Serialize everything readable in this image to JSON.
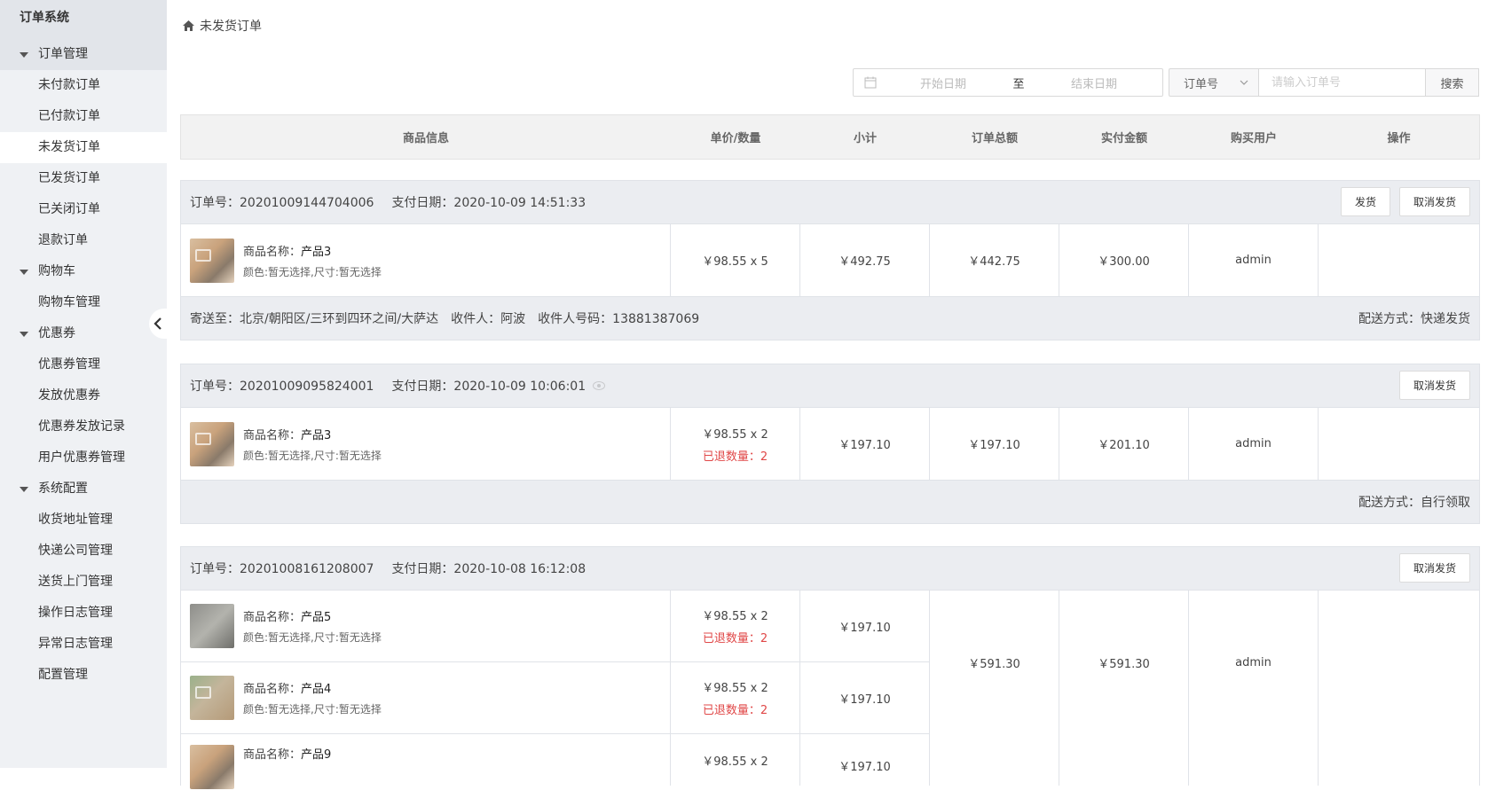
{
  "sidebar": {
    "title": "订单系统",
    "groups": [
      {
        "label": "订单管理",
        "items": [
          "未付款订单",
          "已付款订单",
          "未发货订单",
          "已发货订单",
          "已关闭订单",
          "退款订单"
        ]
      },
      {
        "label": "购物车",
        "items": [
          "购物车管理"
        ]
      },
      {
        "label": "优惠券",
        "items": [
          "优惠券管理",
          "发放优惠券",
          "优惠券发放记录",
          "用户优惠券管理"
        ]
      },
      {
        "label": "系统配置",
        "items": [
          "收货地址管理",
          "快递公司管理",
          "送货上门管理",
          "操作日志管理",
          "异常日志管理",
          "配置管理"
        ]
      }
    ],
    "active_item": "未发货订单"
  },
  "breadcrumb": {
    "label": "未发货订单"
  },
  "filters": {
    "start_placeholder": "开始日期",
    "separator": "至",
    "end_placeholder": "结束日期",
    "select_value": "订单号",
    "input_placeholder": "请输入订单号",
    "search_label": "搜索"
  },
  "table_headers": [
    "商品信息",
    "单价/数量",
    "小计",
    "订单总额",
    "实付金额",
    "购买用户",
    "操作"
  ],
  "orders": [
    {
      "order_no": "订单号：20201009144704006",
      "pay_date": "支付日期：2020-10-09 14:51:33",
      "buttons": [
        "发货",
        "取消发货"
      ],
      "items": [
        {
          "name_label": "商品名称：",
          "name": "产品3",
          "attrs": "颜色:暂无选择,尺寸:暂无选择",
          "price_qty": "￥98.55 x 5",
          "refund": "",
          "subtotal": "￥492.75"
        }
      ],
      "total": "￥442.75",
      "paid": "￥300.00",
      "user": "admin",
      "address": "寄送至：北京/朝阳区/三环到四环之间/大萨达",
      "receiver": "收件人：阿波",
      "phone": "收件人号码：13881387069",
      "shipping": "配送方式：快递发货"
    },
    {
      "order_no": "订单号：20201009095824001",
      "pay_date": "支付日期：2020-10-09 10:06:01",
      "buttons": [
        "取消发货"
      ],
      "items": [
        {
          "name_label": "商品名称：",
          "name": "产品3",
          "attrs": "颜色:暂无选择,尺寸:暂无选择",
          "price_qty": "￥98.55 x 2",
          "refund": "已退数量：2",
          "subtotal": "￥197.10"
        }
      ],
      "total": "￥197.10",
      "paid": "￥201.10",
      "user": "admin",
      "shipping": "配送方式：自行领取"
    },
    {
      "order_no": "订单号：20201008161208007",
      "pay_date": "支付日期：2020-10-08 16:12:08",
      "buttons": [
        "取消发货"
      ],
      "items": [
        {
          "name_label": "商品名称：",
          "name": "产品5",
          "attrs": "颜色:暂无选择,尺寸:暂无选择",
          "price_qty": "￥98.55 x 2",
          "refund": "已退数量：2",
          "subtotal": "￥197.10"
        },
        {
          "name_label": "商品名称：",
          "name": "产品4",
          "attrs": "颜色:暂无选择,尺寸:暂无选择",
          "price_qty": "￥98.55 x 2",
          "refund": "已退数量：2",
          "subtotal": "￥197.10"
        },
        {
          "name_label": "商品名称：",
          "name": "产品9",
          "attrs": "",
          "price_qty": "￥98.55 x 2",
          "refund": "",
          "subtotal": "￥197.10"
        }
      ],
      "total": "￥591.30",
      "paid": "￥591.30",
      "user": "admin"
    }
  ]
}
